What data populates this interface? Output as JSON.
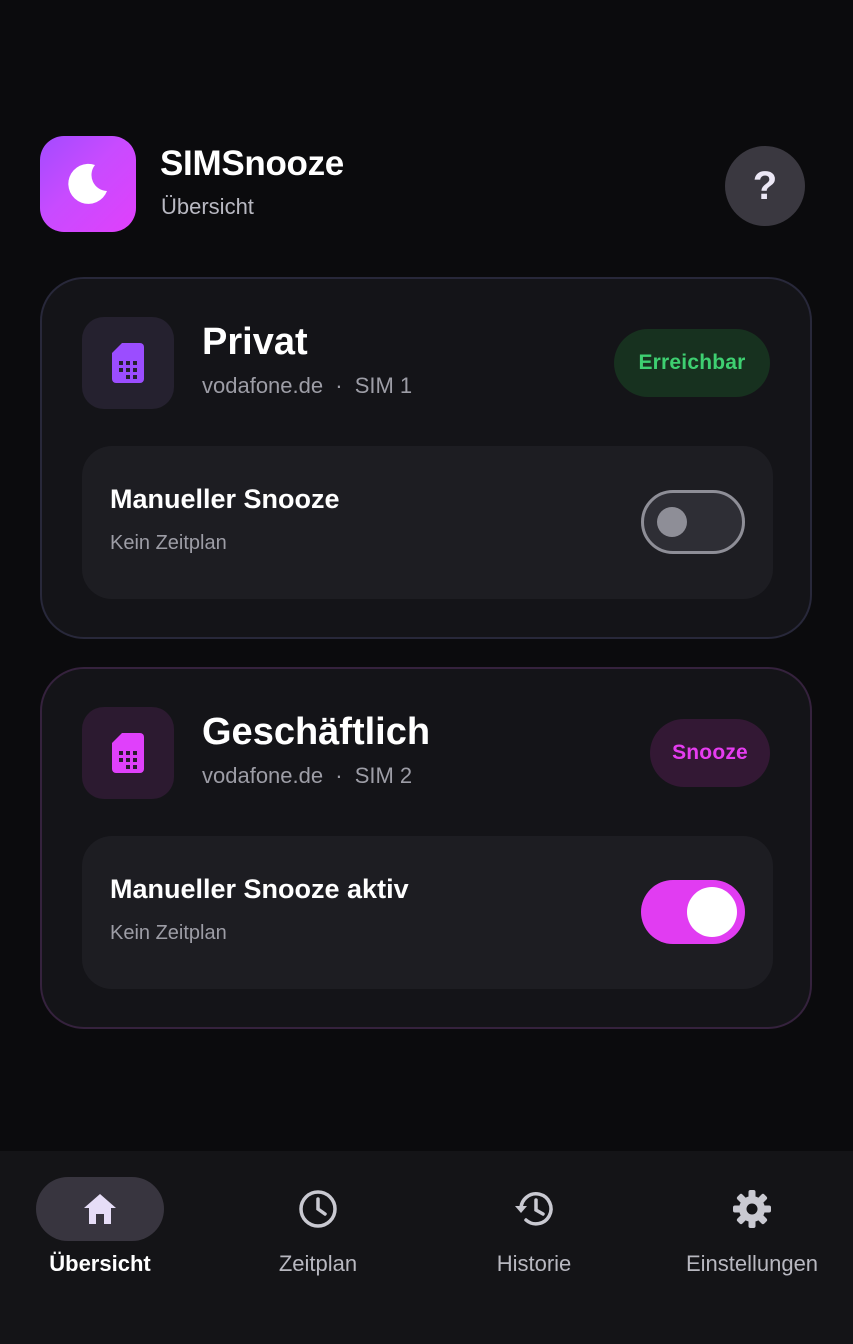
{
  "header": {
    "title": "SIMSnooze",
    "subtitle": "Übersicht",
    "help_label": "?"
  },
  "sims": [
    {
      "name": "Privat",
      "carrier": "vodafone.de",
      "slot": "SIM 1",
      "status": "Erreichbar",
      "status_color": "#3ecf71",
      "snooze_title": "Manueller Snooze",
      "snooze_sub": "Kein Zeitplan",
      "snooze_on": false,
      "icon_color": "#9b4dff"
    },
    {
      "name": "Geschäftlich",
      "carrier": "vodafone.de",
      "slot": "SIM 2",
      "status": "Snooze",
      "status_color": "#e53cf0",
      "snooze_title": "Manueller Snooze aktiv",
      "snooze_sub": "Kein Zeitplan",
      "snooze_on": true,
      "icon_color": "#e040fb"
    }
  ],
  "separator": "·",
  "nav": [
    {
      "label": "Übersicht",
      "icon": "home-icon",
      "active": true
    },
    {
      "label": "Zeitplan",
      "icon": "clock-icon",
      "active": false
    },
    {
      "label": "Historie",
      "icon": "history-icon",
      "active": false
    },
    {
      "label": "Einstellungen",
      "icon": "gear-icon",
      "active": false
    }
  ],
  "colors": {
    "accent": "#e13cf2",
    "background": "#0b0b0d",
    "card": "#141418"
  }
}
